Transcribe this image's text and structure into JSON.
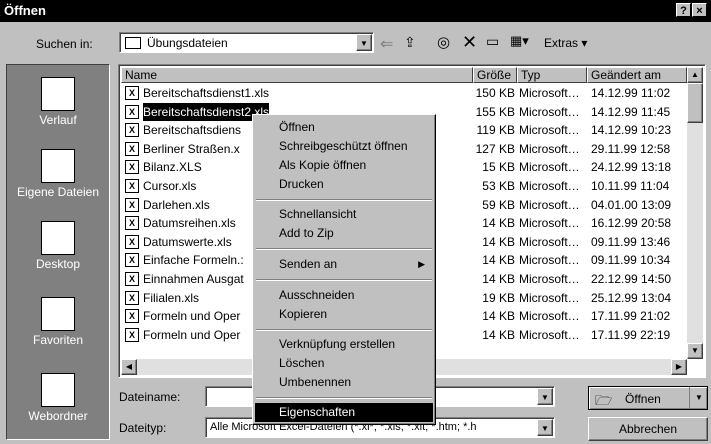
{
  "window": {
    "title": "Öffnen",
    "help": "?",
    "close": "×"
  },
  "toolbar": {
    "look_in_label": "Suchen in:",
    "look_in_value": "Übungsdateien",
    "extras_label": "Extras"
  },
  "places": [
    {
      "label": "Verlauf",
      "icon": "history-icon"
    },
    {
      "label": "Eigene Dateien",
      "icon": "my-documents-icon"
    },
    {
      "label": "Desktop",
      "icon": "desktop-icon"
    },
    {
      "label": "Favoriten",
      "icon": "favorites-icon"
    },
    {
      "label": "Webordner",
      "icon": "web-folder-icon"
    }
  ],
  "columns": {
    "name": "Name",
    "size": "Größe",
    "type": "Typ",
    "modified": "Geändert am"
  },
  "files": [
    {
      "name": "Bereitschaftsdienst1.xls",
      "size": "150 KB",
      "type": "Microsoft…",
      "modified": "14.12.99 11:02"
    },
    {
      "name": "Bereitschaftsdienst2.xls",
      "size": "155 KB",
      "type": "Microsoft…",
      "modified": "14.12.99 11:45"
    },
    {
      "name": "Bereitschaftsdiens",
      "size": "119 KB",
      "type": "Microsoft…",
      "modified": "14.12.99 10:23"
    },
    {
      "name": "Berliner Straßen.x",
      "size": "127 KB",
      "type": "Microsoft…",
      "modified": "29.11.99 12:58"
    },
    {
      "name": "Bilanz.XLS",
      "size": "15 KB",
      "type": "Microsoft…",
      "modified": "24.12.99 13:18"
    },
    {
      "name": "Cursor.xls",
      "size": "53 KB",
      "type": "Microsoft…",
      "modified": "10.11.99 11:04"
    },
    {
      "name": "Darlehen.xls",
      "size": "59 KB",
      "type": "Microsoft…",
      "modified": "04.01.00 13:09"
    },
    {
      "name": "Datumsreihen.xls",
      "size": "14 KB",
      "type": "Microsoft…",
      "modified": "16.12.99 20:58"
    },
    {
      "name": "Datumswerte.xls",
      "size": "14 KB",
      "type": "Microsoft…",
      "modified": "09.11.99 13:46"
    },
    {
      "name": "Einfache Formeln.:",
      "size": "14 KB",
      "type": "Microsoft…",
      "modified": "09.11.99 10:34"
    },
    {
      "name": "Einnahmen Ausgat",
      "size": "14 KB",
      "type": "Microsoft…",
      "modified": "22.12.99 14:50"
    },
    {
      "name": "Filialen.xls",
      "size": "19 KB",
      "type": "Microsoft…",
      "modified": "25.12.99 13:04"
    },
    {
      "name": "Formeln und Oper",
      "size": "14 KB",
      "type": "Microsoft…",
      "modified": "17.11.99 21:02"
    },
    {
      "name": "Formeln und Oper",
      "size": "14 KB",
      "type": "Microsoft…",
      "modified": "17.11.99 22:19"
    }
  ],
  "context_menu": {
    "open": "Öffnen",
    "open_readonly": "Schreibgeschützt öffnen",
    "open_copy": "Als Kopie öffnen",
    "print": "Drucken",
    "quick_view": "Schnellansicht",
    "add_zip": "Add to Zip",
    "send_to": "Senden an",
    "cut": "Ausschneiden",
    "copy": "Kopieren",
    "create_shortcut": "Verknüpfung erstellen",
    "delete": "Löschen",
    "rename": "Umbenennen",
    "properties": "Eigenschaften"
  },
  "bottom": {
    "filename_label": "Dateiname:",
    "filename_value": "",
    "filetype_label": "Dateityp:",
    "filetype_value": "Alle Microsoft Excel-Dateien (*.xl*; *.xls; *.xlt; *.htm; *.h",
    "open_button": "Öffnen",
    "cancel_button": "Abbrechen"
  }
}
